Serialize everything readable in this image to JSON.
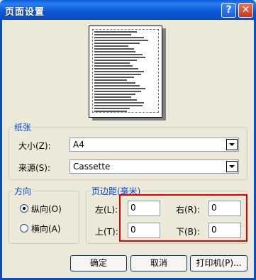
{
  "window": {
    "title": "页面设置",
    "help_label": "?",
    "close_label": "✕"
  },
  "paper": {
    "group_label": "纸张",
    "size_label": "大小(Z):",
    "size_value": "A4",
    "source_label": "来源(S):",
    "source_value": "Cassette"
  },
  "orientation": {
    "group_label": "方向",
    "portrait_label": "纵向(O)",
    "landscape_label": "横向(A)",
    "selected": "portrait"
  },
  "margins": {
    "group_label": "页边距(毫米)",
    "left_label": "左(L):",
    "left_value": "0",
    "right_label": "右(R):",
    "right_value": "0",
    "top_label": "上(T):",
    "top_value": "0",
    "bottom_label": "下(B):",
    "bottom_value": "0"
  },
  "buttons": {
    "ok": "确定",
    "cancel": "取消",
    "printer": "打印机(P)..."
  },
  "colors": {
    "titlebar": "#0A5FDB",
    "dialog_bg": "#ECE9D8",
    "group_label": "#0046D5",
    "highlight": "#E00000"
  },
  "icons": {
    "help": "question-icon",
    "close": "close-icon",
    "dropdown": "chevron-down-icon"
  }
}
